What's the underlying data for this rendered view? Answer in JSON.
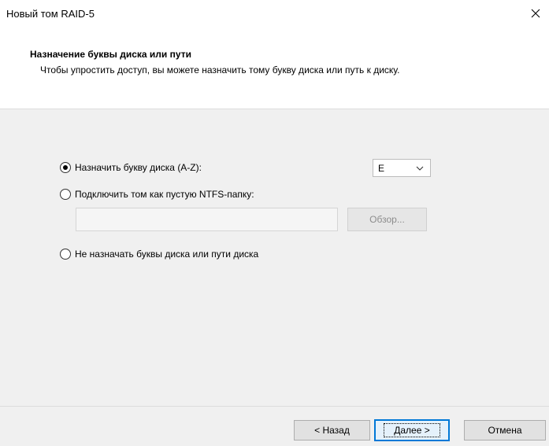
{
  "window": {
    "title": "Новый том RAID-5"
  },
  "header": {
    "title": "Назначение буквы диска или пути",
    "description": "Чтобы упростить доступ, вы можете назначить тому букву диска или путь к диску."
  },
  "options": {
    "assign_letter": {
      "label": "Назначить букву диска (A-Z):",
      "selected": true
    },
    "mount_folder": {
      "label": "Подключить том как пустую NTFS-папку:",
      "selected": false
    },
    "no_letter": {
      "label": "Не назначать буквы диска или пути диска",
      "selected": false
    }
  },
  "drive_select": {
    "value": "E"
  },
  "folder_path": {
    "value": ""
  },
  "browse_button": {
    "label": "Обзор..."
  },
  "footer": {
    "back_label": "< Назад",
    "next_label": "Далее >",
    "cancel_label": "Отмена"
  },
  "colors": {
    "content_bg": "#f0f0f0",
    "accent": "#0078d7"
  },
  "icons": {
    "close": "close-icon",
    "dropdown": "chevron-down-icon"
  }
}
